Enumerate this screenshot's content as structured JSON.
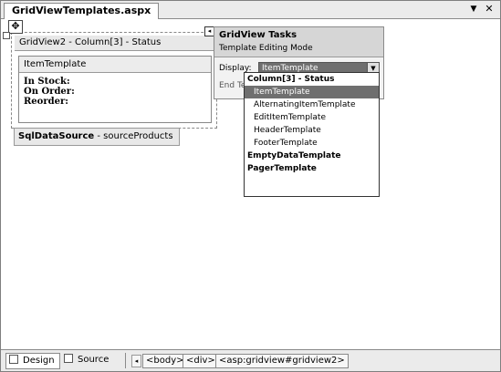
{
  "document_tab": {
    "title": "GridViewTemplates.aspx"
  },
  "window_buttons": {
    "dropdown_glyph": "▼",
    "close_glyph": "✕"
  },
  "gridview": {
    "header": "GridView2 - Column[3] - Status",
    "item_template_title": "ItemTemplate",
    "lines": [
      "In Stock:",
      "On Order:",
      "Reorder:"
    ],
    "move_glyph": "✥"
  },
  "sqldatasource": {
    "name": "SqlDataSource",
    "suffix": " - sourceProducts"
  },
  "tasks": {
    "arrow_glyph": "◂",
    "title": "GridView Tasks",
    "subtitle": "Template Editing Mode",
    "display_label": "Display:",
    "display_value": "ItemTemplate",
    "end_editing": "End Template Editing"
  },
  "dropdown": {
    "items": [
      {
        "label": "Column[3] - Status",
        "kind": "group"
      },
      {
        "label": "ItemTemplate",
        "kind": "sub",
        "selected": true
      },
      {
        "label": "AlternatingItemTemplate",
        "kind": "sub"
      },
      {
        "label": "EditItemTemplate",
        "kind": "sub"
      },
      {
        "label": "HeaderTemplate",
        "kind": "sub"
      },
      {
        "label": "FooterTemplate",
        "kind": "sub"
      },
      {
        "label": "EmptyDataTemplate",
        "kind": "group"
      },
      {
        "label": "PagerTemplate",
        "kind": "group"
      }
    ]
  },
  "bottombar": {
    "design_label": "Design",
    "source_label": "Source",
    "breadcrumbs": [
      "<body>",
      "<div>",
      "<asp:gridview#gridview2>"
    ],
    "scroll_left_glyph": "◂"
  }
}
